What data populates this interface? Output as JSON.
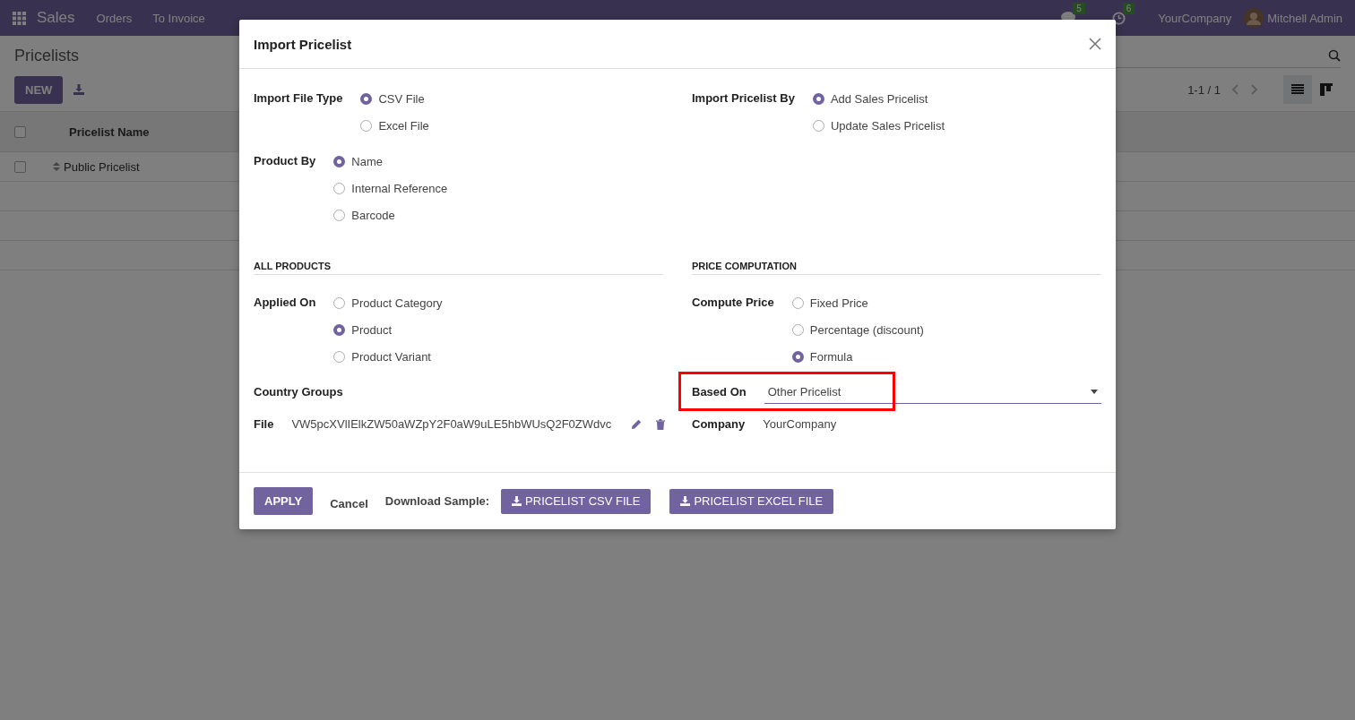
{
  "navbar": {
    "app": "Sales",
    "menu": [
      "Orders",
      "To Invoice"
    ],
    "messages_count": "5",
    "activities_count": "6",
    "company": "YourCompany",
    "user": "Mitchell Admin"
  },
  "control_panel": {
    "title": "Pricelists",
    "new_button": "NEW",
    "pager": "1-1 / 1",
    "views": [
      {
        "kind": "list",
        "selected": true
      },
      {
        "kind": "kanban",
        "selected": false
      }
    ]
  },
  "table": {
    "select_all_checked": false,
    "columns": [
      "Pricelist Name"
    ],
    "rows": [
      {
        "checked": false,
        "cells": [
          "Public Pricelist"
        ]
      }
    ]
  },
  "dialog": {
    "title": "Import Pricelist",
    "top_columns": [
      {
        "fields": [
          {
            "label": "Import File Type",
            "kind": "radio",
            "options": [
              {
                "label": "CSV File",
                "selected": true
              },
              {
                "label": "Excel File",
                "selected": false
              }
            ]
          },
          {
            "label": "Product By",
            "kind": "radio",
            "options": [
              {
                "label": "Name",
                "selected": true
              },
              {
                "label": "Internal Reference",
                "selected": false
              },
              {
                "label": "Barcode",
                "selected": false
              }
            ]
          }
        ]
      },
      {
        "fields": [
          {
            "label": "Import Pricelist By",
            "kind": "radio",
            "options": [
              {
                "label": "Add Sales Pricelist",
                "selected": true
              },
              {
                "label": "Update Sales Pricelist",
                "selected": false
              }
            ]
          }
        ]
      }
    ],
    "sections": [
      {
        "heading": "ALL PRODUCTS",
        "fields": [
          {
            "label": "Applied On",
            "kind": "radio",
            "options": [
              {
                "label": "Product Category",
                "selected": false
              },
              {
                "label": "Product",
                "selected": true
              },
              {
                "label": "Product Variant",
                "selected": false
              }
            ]
          },
          {
            "label": "Country Groups",
            "kind": "empty"
          },
          {
            "label": "File",
            "kind": "file",
            "value": "VW5pcXVlIElkZW50aWZpY2F0aW9uLE5hbWUsQ2F0ZWdvc"
          }
        ]
      },
      {
        "heading": "PRICE COMPUTATION",
        "fields": [
          {
            "label": "Compute Price",
            "kind": "radio",
            "options": [
              {
                "label": "Fixed Price",
                "selected": false
              },
              {
                "label": "Percentage (discount)",
                "selected": false
              },
              {
                "label": "Formula",
                "selected": true
              }
            ]
          },
          {
            "label": "Based On",
            "kind": "select",
            "value": "Other Pricelist",
            "highlighted": true
          },
          {
            "label": "Company",
            "kind": "text",
            "value": "YourCompany"
          }
        ]
      }
    ],
    "footer": {
      "apply": "APPLY",
      "cancel": "Cancel",
      "download_label": "Download Sample:",
      "downloads": [
        "PRICELIST CSV FILE",
        "PRICELIST EXCEL FILE"
      ]
    }
  }
}
